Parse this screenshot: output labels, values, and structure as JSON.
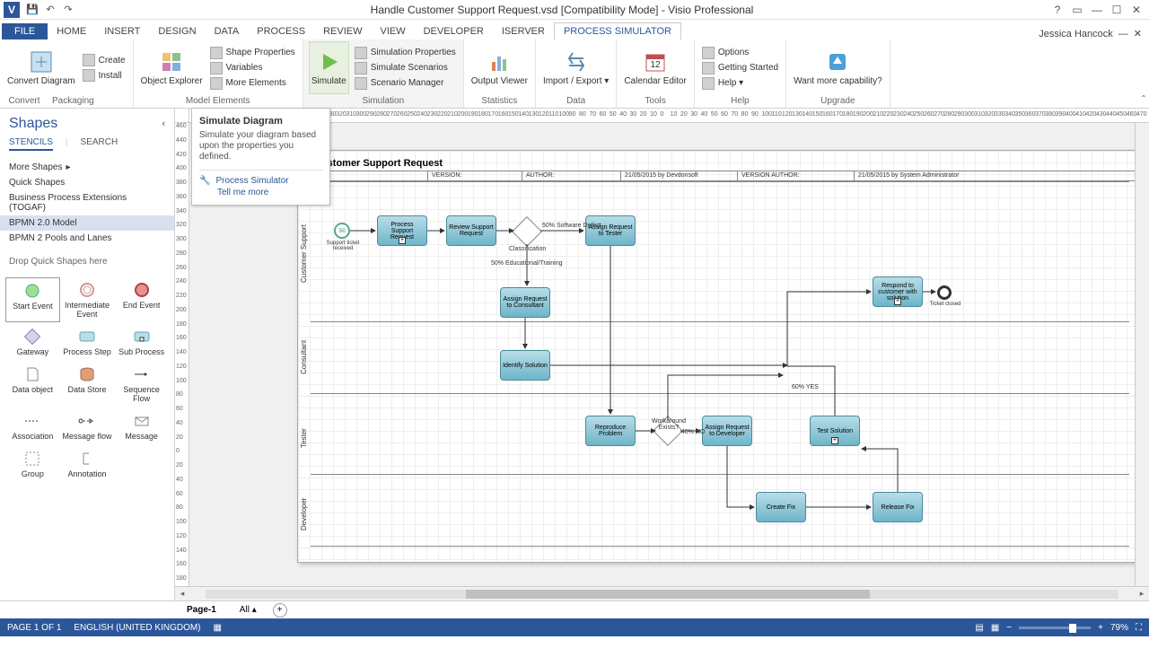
{
  "app": {
    "title": "Handle Customer Support Request.vsd  [Compatibility Mode] - Visio Professional",
    "user": "Jessica Hancock"
  },
  "tabs": {
    "file": "FILE",
    "items": [
      "HOME",
      "INSERT",
      "DESIGN",
      "DATA",
      "PROCESS",
      "REVIEW",
      "VIEW",
      "DEVELOPER",
      "ISERVER",
      "PROCESS SIMULATOR"
    ],
    "active_index": 9
  },
  "ribbon": {
    "groups": [
      {
        "label": "Convert",
        "items_big": [
          {
            "label": "Convert\nDiagram"
          }
        ],
        "items_small": [
          {
            "label": "Create"
          },
          {
            "label": "Install"
          }
        ],
        "small_group_label": "Packaging"
      },
      {
        "label": "Model Elements",
        "items_big": [
          {
            "label": "Object\nExplorer"
          }
        ],
        "items_small": [
          {
            "label": "Shape Properties"
          },
          {
            "label": "Variables"
          },
          {
            "label": "More Elements"
          }
        ]
      },
      {
        "label": "Simulation",
        "items_big": [
          {
            "label": "Simulate"
          }
        ],
        "items_small": [
          {
            "label": "Simulation Properties"
          },
          {
            "label": "Simulate Scenarios"
          },
          {
            "label": "Scenario Manager"
          }
        ]
      },
      {
        "label": "Statistics",
        "items_big": [
          {
            "label": "Output\nViewer"
          }
        ]
      },
      {
        "label": "Data",
        "items_big": [
          {
            "label": "Import /\nExport ▾"
          }
        ]
      },
      {
        "label": "Tools",
        "items_big": [
          {
            "label": "Calendar\nEditor"
          }
        ]
      },
      {
        "label": "Help",
        "items_small": [
          {
            "label": "Options"
          },
          {
            "label": "Getting Started"
          },
          {
            "label": "Help ▾"
          }
        ]
      },
      {
        "label": "Upgrade",
        "items_big": [
          {
            "label": "Want more\ncapability?"
          }
        ]
      }
    ]
  },
  "tooltip": {
    "title": "Simulate Diagram",
    "desc": "Simulate your diagram based upon the properties you defined.",
    "link": "Process Simulator",
    "tell": "Tell me more"
  },
  "shapes": {
    "heading": "Shapes",
    "tab1": "STENCILS",
    "tab2": "SEARCH",
    "more": "More Shapes",
    "stencils": [
      "Quick Shapes",
      "Business Process Extensions (TOGAF)",
      "BPMN 2.0 Model",
      "BPMN 2 Pools and Lanes"
    ],
    "selected_index": 2,
    "drop_hint": "Drop Quick Shapes here",
    "palette": [
      {
        "label": "Start Event"
      },
      {
        "label": "Intermediate Event"
      },
      {
        "label": "End Event"
      },
      {
        "label": "Gateway"
      },
      {
        "label": "Process Step"
      },
      {
        "label": "Sub Process"
      },
      {
        "label": "Data object"
      },
      {
        "label": "Data Store"
      },
      {
        "label": "Sequence Flow"
      },
      {
        "label": "Association"
      },
      {
        "label": "Message flow"
      },
      {
        "label": "Message"
      },
      {
        "label": "Group"
      },
      {
        "label": "Annotation"
      }
    ]
  },
  "diagram": {
    "title": "Customer Support Request",
    "meta": {
      "version_label": "VERSION:",
      "author_label": "AUTHOR:",
      "date1": "21/05/2015 by Devdonsoft",
      "vauthor": "VERSION AUTHOR:",
      "date2": "21/05/2015 by System Administrator"
    },
    "lanes": [
      "Customer Support",
      "Consultant",
      "Tester",
      "Developer"
    ],
    "events": {
      "start": "Support ticket received",
      "end": "Ticket closed"
    },
    "tasks": {
      "t1": "Process Support Request",
      "t2": "Review Support Request",
      "t3": "Assign Request to Tester",
      "t4": "Assign Request to Consultant",
      "t5": "Identify Solution",
      "t6": "Respond to customer with solution",
      "t7": "Reproduce Problem",
      "t8": "Assign Request to Developer",
      "t9": "Test Solution",
      "t10": "Create Fix",
      "t11": "Release Fix"
    },
    "gateways": {
      "g1": "Classification",
      "g2": "Workaround Exists?"
    },
    "labels": {
      "l1": "50% Software Defect",
      "l2": "50% Educational/Training",
      "l3": "60% YES",
      "l4": "40% NO"
    }
  },
  "pagebar": {
    "page": "Page-1",
    "all": "All ▴"
  },
  "status": {
    "page": "PAGE 1 OF 1",
    "lang": "ENGLISH (UNITED KINGDOM)",
    "zoom": "79%"
  }
}
